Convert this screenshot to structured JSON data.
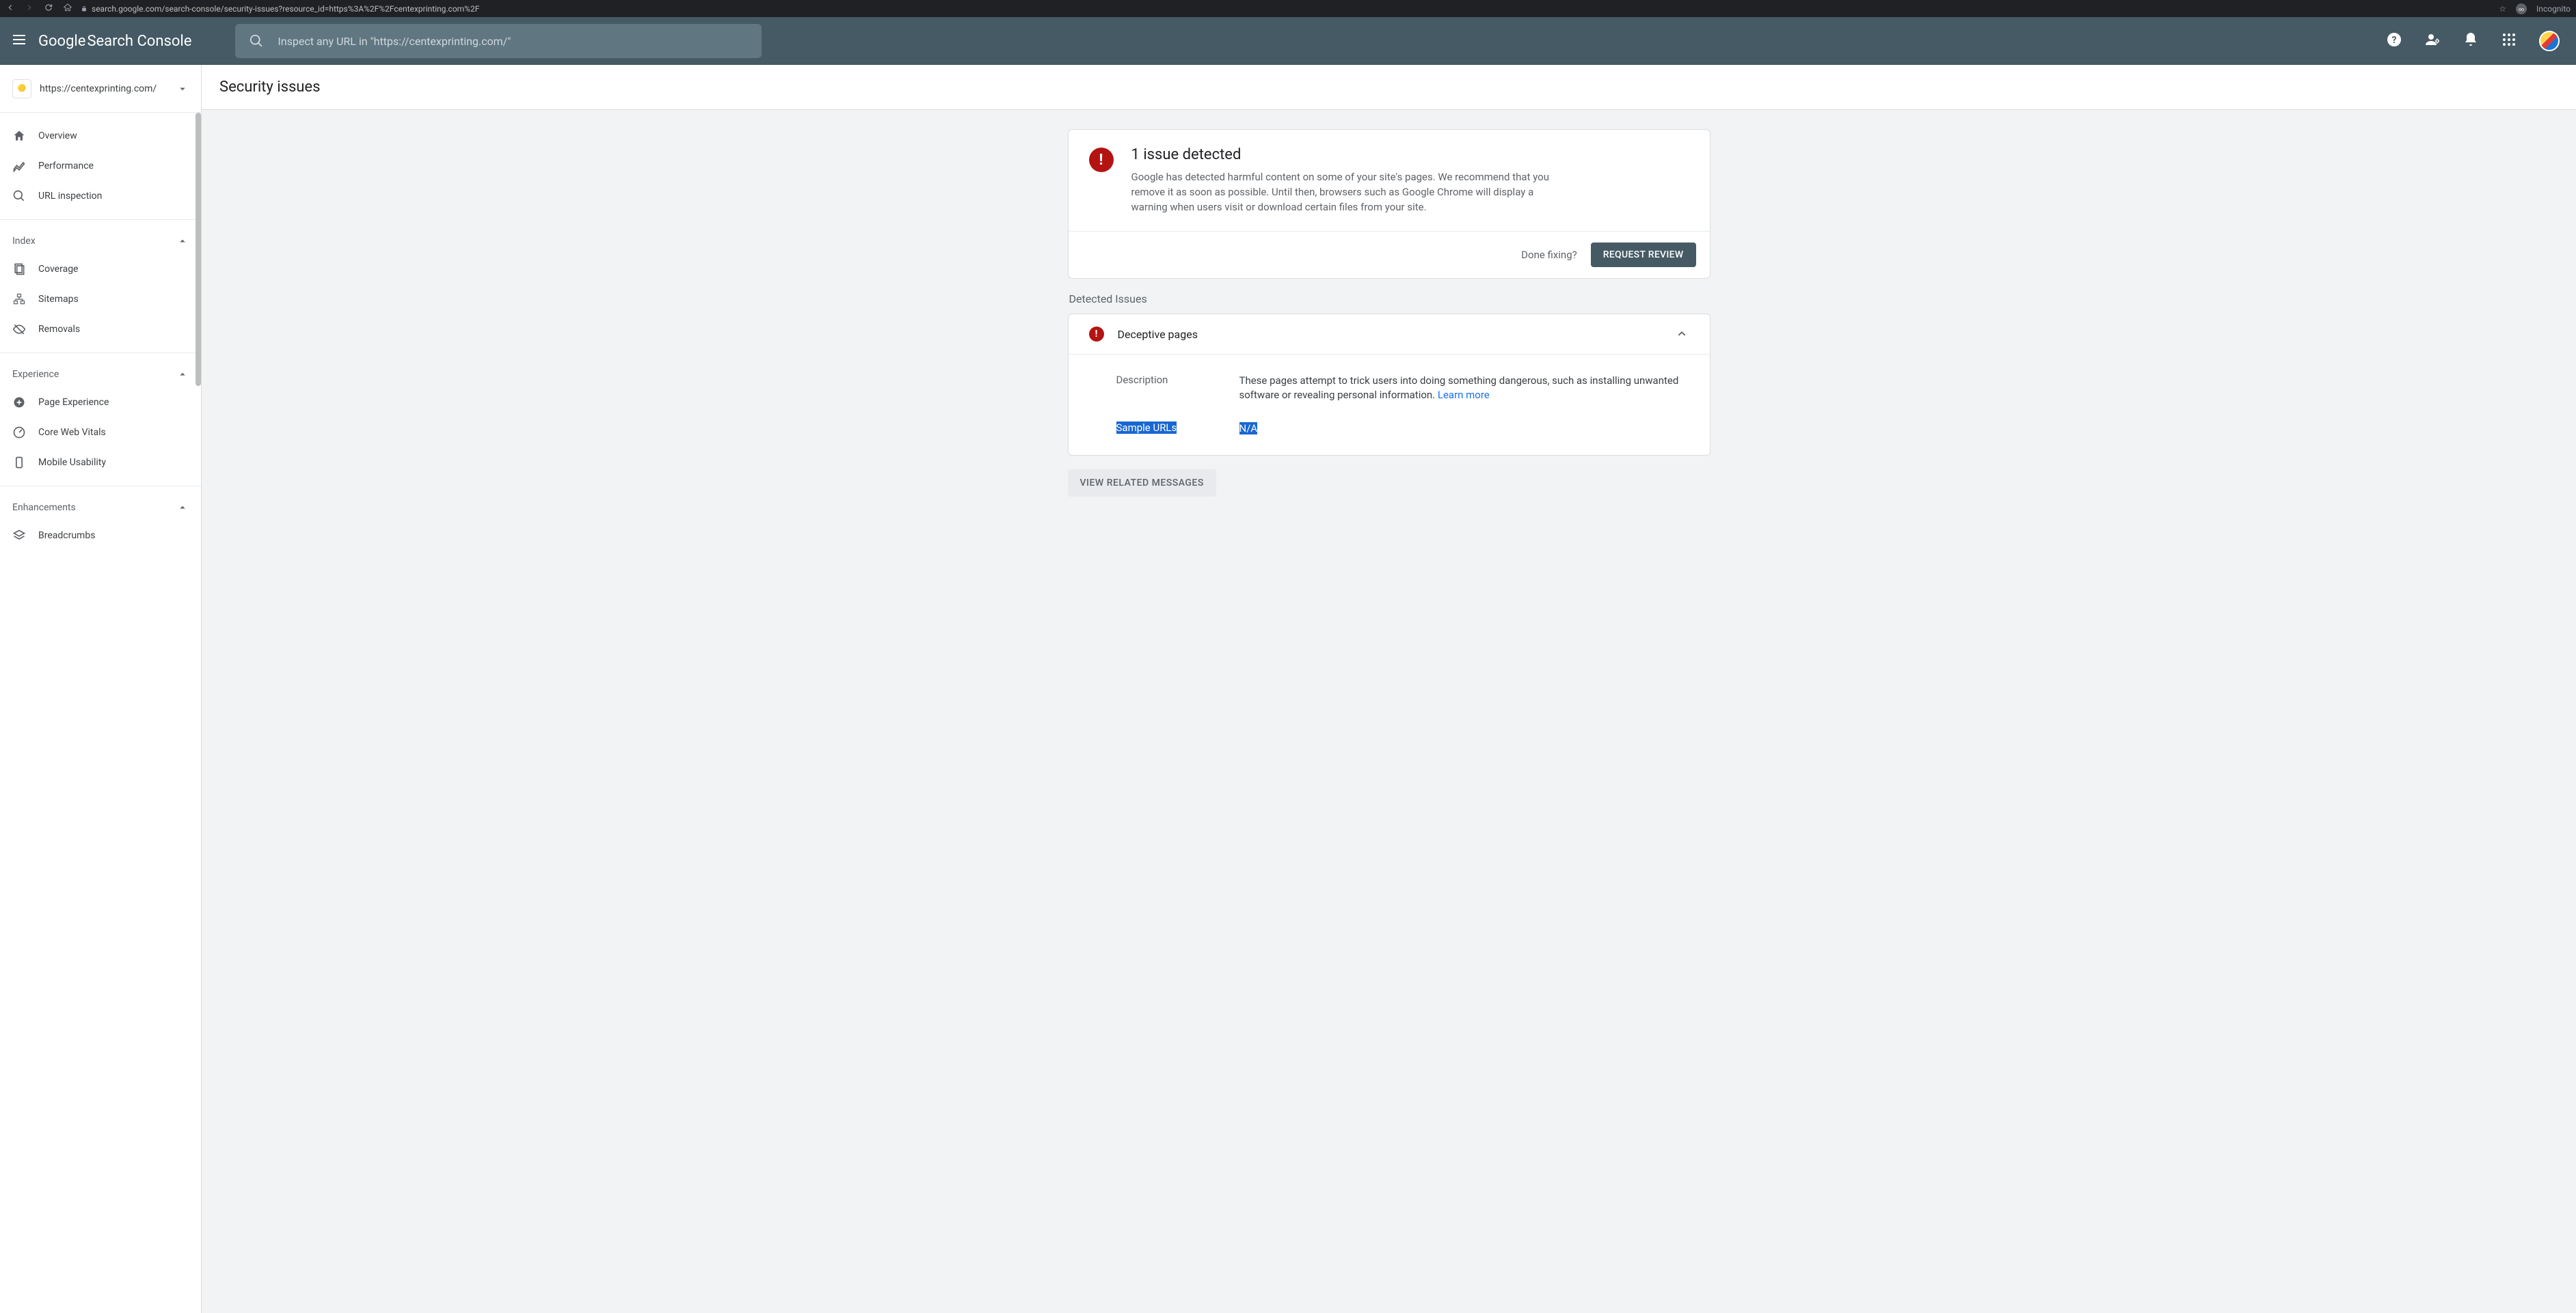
{
  "browser": {
    "url": "search.google.com/search-console/security-issues?resource_id=https%3A%2F%2Fcentexprinting.com%2F",
    "incognito_label": "Incognito"
  },
  "header": {
    "logo_part1": "Google",
    "logo_part2": " Search Console",
    "search_placeholder": "Inspect any URL in \"https://centexprinting.com/\""
  },
  "sidebar": {
    "property": "https://centexprinting.com/",
    "items_top": [
      {
        "label": "Overview"
      },
      {
        "label": "Performance"
      },
      {
        "label": "URL inspection"
      }
    ],
    "section_index": {
      "title": "Index",
      "items": [
        {
          "label": "Coverage"
        },
        {
          "label": "Sitemaps"
        },
        {
          "label": "Removals"
        }
      ]
    },
    "section_experience": {
      "title": "Experience",
      "items": [
        {
          "label": "Page Experience"
        },
        {
          "label": "Core Web Vitals"
        },
        {
          "label": "Mobile Usability"
        }
      ]
    },
    "section_enhancements": {
      "title": "Enhancements",
      "items": [
        {
          "label": "Breadcrumbs"
        }
      ]
    }
  },
  "page": {
    "title": "Security issues",
    "issue_count_title": "1 issue detected",
    "issue_description": "Google has detected harmful content on some of your site's pages. We recommend that you remove it as soon as possible. Until then, browsers such as Google Chrome will display a warning when users visit or download certain files from your site.",
    "done_fixing": "Done fixing?",
    "request_review": "REQUEST REVIEW",
    "detected_label": "Detected Issues",
    "issue": {
      "name": "Deceptive pages",
      "description_label": "Description",
      "description_value": "These pages attempt to trick users into doing something dangerous, such as installing unwanted software or revealing personal information. ",
      "learn_more": "Learn more",
      "sample_label": "Sample URLs",
      "sample_value": "N/A"
    },
    "related_button": "VIEW RELATED MESSAGES"
  }
}
